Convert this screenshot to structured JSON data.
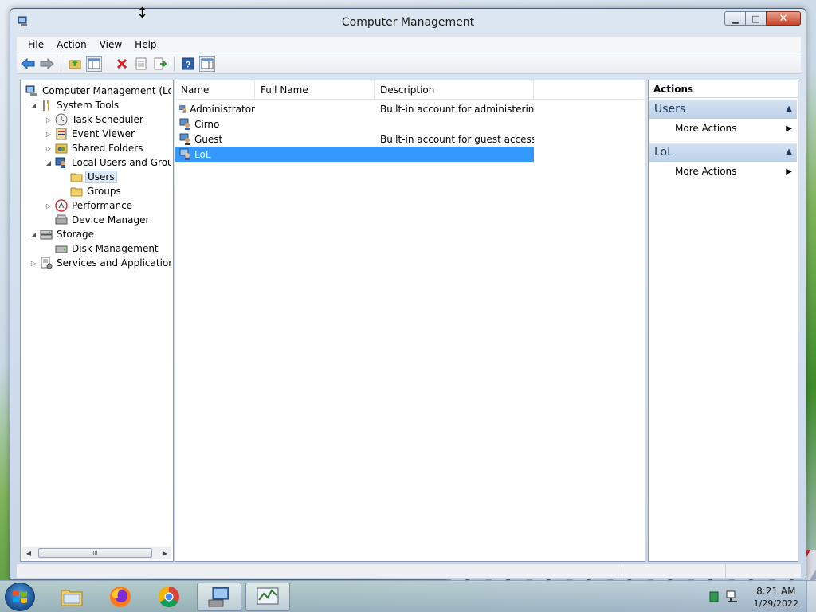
{
  "window": {
    "title": "Computer Management",
    "minimize": "▁",
    "maximize": "□",
    "close": "✕"
  },
  "menu": [
    "File",
    "Action",
    "View",
    "Help"
  ],
  "toolbar": {
    "icons": [
      "back-arrow-icon",
      "forward-arrow-icon",
      "up-folder-icon",
      "show-hide-console-tree-icon",
      "delete-icon",
      "properties-icon",
      "export-list-icon",
      "help-icon",
      "show-hide-action-pane-icon"
    ]
  },
  "tree": {
    "items": [
      {
        "label": "Computer Management (Local",
        "expander": "",
        "icon": "computer-management-icon"
      },
      {
        "label": "System Tools",
        "expander": "◢",
        "icon": "system-tools-icon"
      },
      {
        "label": "Task Scheduler",
        "expander": "▷",
        "icon": "task-scheduler-icon"
      },
      {
        "label": "Event Viewer",
        "expander": "▷",
        "icon": "event-viewer-icon"
      },
      {
        "label": "Shared Folders",
        "expander": "▷",
        "icon": "shared-folders-icon"
      },
      {
        "label": "Local Users and Groups",
        "expander": "◢",
        "icon": "local-users-groups-icon"
      },
      {
        "label": "Users",
        "expander": "",
        "icon": "folder-icon"
      },
      {
        "label": "Groups",
        "expander": "",
        "icon": "folder-icon"
      },
      {
        "label": "Performance",
        "expander": "▷",
        "icon": "performance-icon"
      },
      {
        "label": "Device Manager",
        "expander": "",
        "icon": "device-manager-icon"
      },
      {
        "label": "Storage",
        "expander": "◢",
        "icon": "storage-icon"
      },
      {
        "label": "Disk Management",
        "expander": "",
        "icon": "disk-management-icon"
      },
      {
        "label": "Services and Applications",
        "expander": "▷",
        "icon": "services-applications-icon"
      }
    ],
    "scroll_left": "◀",
    "scroll_right": "▶",
    "scroll_grip": "III"
  },
  "list": {
    "columns": [
      "Name",
      "Full Name",
      "Description"
    ],
    "rows": [
      {
        "name": "Administrator",
        "full_name": "",
        "description": "Built-in account for administering..."
      },
      {
        "name": "Cirno",
        "full_name": "",
        "description": ""
      },
      {
        "name": "Guest",
        "full_name": "",
        "description": "Built-in account for guest access t..."
      },
      {
        "name": "LoL",
        "full_name": "",
        "description": ""
      }
    ]
  },
  "actions": {
    "title": "Actions",
    "sections": [
      {
        "header": "Users",
        "item": "More Actions"
      },
      {
        "header": "LoL",
        "item": "More Actions"
      }
    ],
    "caret": "▲",
    "arrow": "▶"
  },
  "taskbar": {
    "apps": [
      "file-explorer-icon",
      "firefox-icon",
      "chrome-icon",
      "computer-management-icon",
      "performance-monitor-icon"
    ],
    "time": "8:21 AM",
    "date": "1/29/2022"
  }
}
